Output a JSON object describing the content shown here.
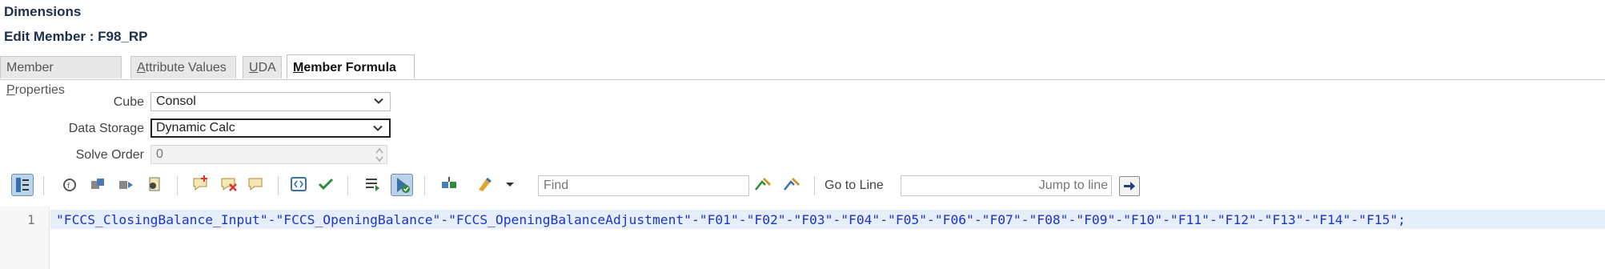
{
  "header": {
    "title": "Dimensions",
    "subtitle": "Edit Member : F98_RP"
  },
  "tabs": [
    {
      "label_pre": "Member ",
      "label_ul": "P",
      "label_post": "roperties",
      "active": false
    },
    {
      "label_pre": "",
      "label_ul": "A",
      "label_post": "ttribute Values",
      "active": false
    },
    {
      "label_pre": "",
      "label_ul": "U",
      "label_post": "DA",
      "active": false
    },
    {
      "label_pre": "",
      "label_ul": "M",
      "label_post": "ember Formula",
      "active": true
    }
  ],
  "form": {
    "cube_label": "Cube",
    "cube_value": "Consol",
    "storage_label": "Data Storage",
    "storage_value": "Dynamic Calc",
    "solve_label": "Solve Order",
    "solve_value": "0"
  },
  "toolbar": {
    "icons": [
      "line-numbers-toggle-icon",
      "function-icon",
      "member-select-icon",
      "smart-list-icon",
      "script-icon",
      "add-comment-icon",
      "remove-comment-icon",
      "comment-icon",
      "expand-icon",
      "validate-icon",
      "format-icon",
      "check-syntax-icon",
      "insert-member-icon",
      "highlight-icon",
      "dropdown-icon",
      "find-next-icon",
      "find-previous-icon"
    ],
    "find_placeholder": "Find",
    "goto_label": "Go to Line",
    "jump_placeholder": "Jump to line"
  },
  "editor": {
    "line_number": "1",
    "code": "\"FCCS_ClosingBalance_Input\"-\"FCCS_OpeningBalance\"-\"FCCS_OpeningBalanceAdjustment\"-\"F01\"-\"F02\"-\"F03\"-\"F04\"-\"F05\"-\"F06\"-\"F07\"-\"F08\"-\"F09\"-\"F10\"-\"F11\"-\"F12\"-\"F13\"-\"F14\"-\"F15\";"
  },
  "colors": {
    "title": "#1c2f4c",
    "code": "#1e35c9",
    "active_line": "#e6eefa",
    "toggle_on": "#bcd3ec"
  }
}
